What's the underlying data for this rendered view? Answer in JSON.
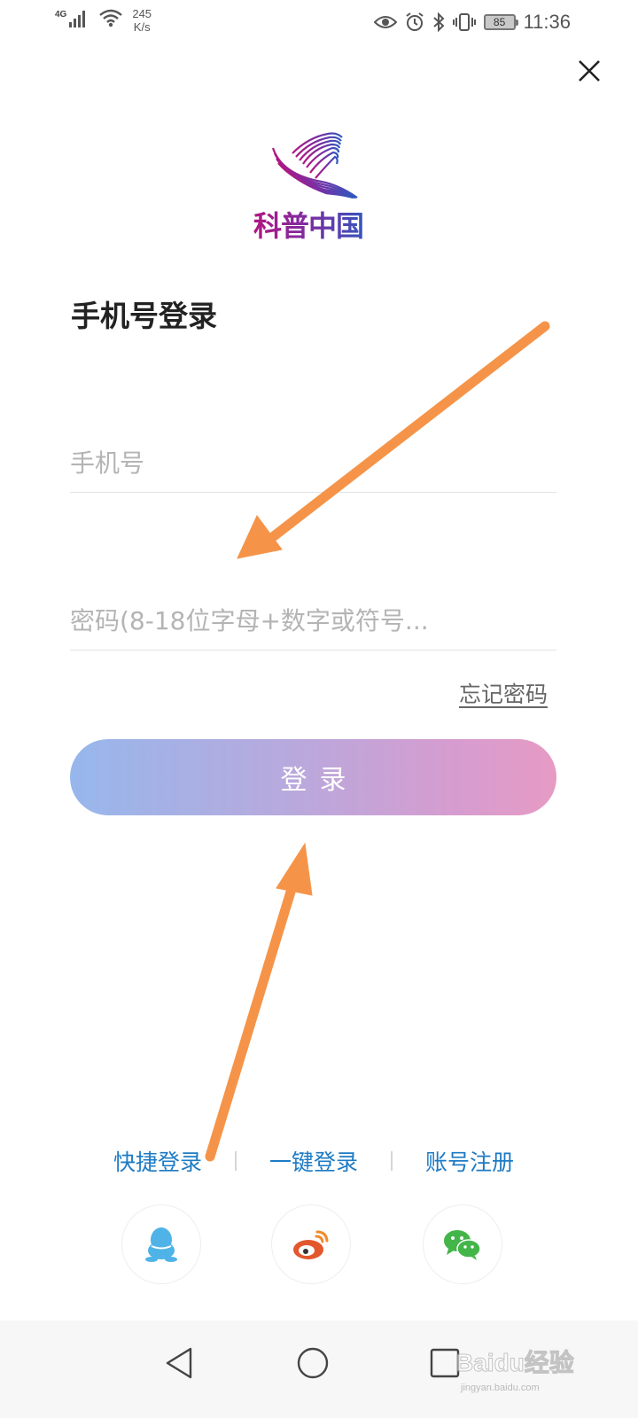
{
  "status_bar": {
    "network_type": "4G",
    "net_speed_value": "245",
    "net_speed_unit": "K/s",
    "battery_level": "85",
    "time": "11:36",
    "icons": [
      "signal-icon",
      "wifi-icon",
      "eye-icon",
      "alarm-icon",
      "bluetooth-icon",
      "vibrate-icon",
      "battery-icon"
    ]
  },
  "header": {
    "close_icon": "close-icon"
  },
  "logo": {
    "text": "科普中国",
    "colors": [
      "#b01782",
      "#7a2ea3",
      "#2f58bf"
    ]
  },
  "login_form": {
    "title": "手机号登录",
    "phone_placeholder": "手机号",
    "password_placeholder": "密码(8-18位字母+数字或符号...",
    "forgot_password": "忘记密码",
    "submit_label": "登录"
  },
  "alt_login": {
    "options": [
      "快捷登录",
      "一键登录",
      "账号注册"
    ],
    "link_color": "#1e7bc4"
  },
  "social": {
    "icons": [
      "qq-icon",
      "weibo-icon",
      "wechat-icon"
    ],
    "colors": {
      "qq": "#4fb3e8",
      "weibo": "#e2572c",
      "wechat": "#44b549"
    }
  },
  "annotation": {
    "arrow_color": "#f59448"
  },
  "nav_bar": {
    "icons": [
      "back-triangle-icon",
      "home-circle-icon",
      "recents-square-icon"
    ]
  },
  "watermark": {
    "text": "Baidu经验",
    "url": "jingyan.baidu.com"
  }
}
